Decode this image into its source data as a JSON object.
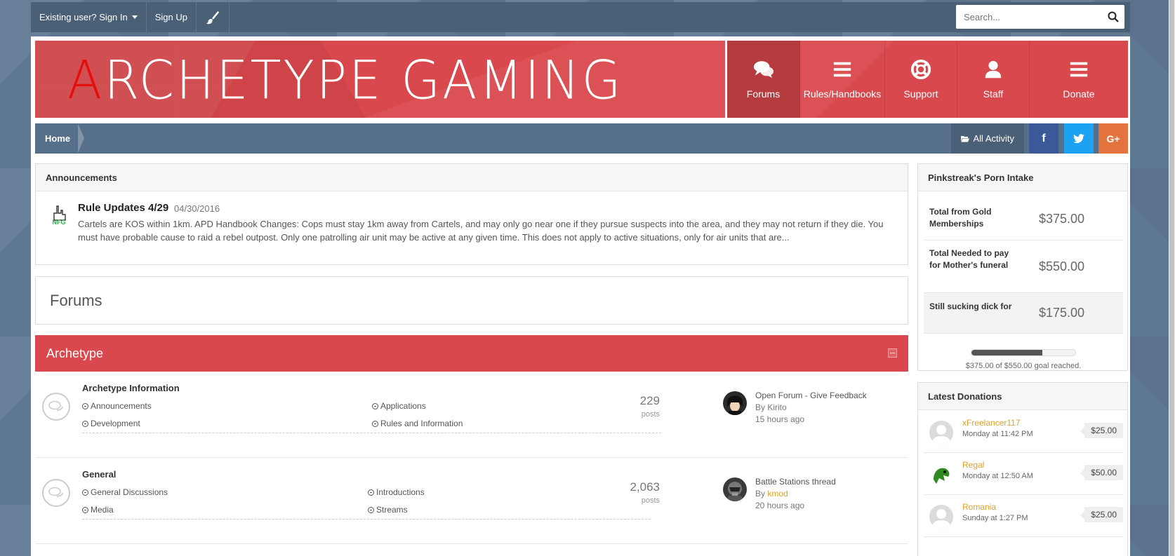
{
  "userbar": {
    "sign_in": "Existing user? Sign In",
    "sign_up": "Sign Up",
    "theme_icon": "paintbrush-icon"
  },
  "search": {
    "placeholder": "Search..."
  },
  "brand": {
    "first_letter": "A",
    "rest": "RCHETYPE GAMING",
    "accent_color": "#e60d0d"
  },
  "nav": [
    {
      "label": "Forums",
      "icon": "comments-icon",
      "active": true
    },
    {
      "label": "Rules/Handbooks",
      "icon": "bars-icon",
      "active": false
    },
    {
      "label": "Support",
      "icon": "lifebuoy-icon",
      "active": false
    },
    {
      "label": "Staff",
      "icon": "user-icon",
      "active": false
    },
    {
      "label": "Donate",
      "icon": "bars-icon",
      "active": false
    }
  ],
  "breadcrumb": {
    "home": "Home",
    "all_activity": "All Activity"
  },
  "social": {
    "facebook": "f",
    "twitter": "twitter-icon",
    "google": "G+"
  },
  "announcements": {
    "heading": "Announcements",
    "title": "Rule Updates 4/29",
    "date": "04/30/2016",
    "body": "Cartels are KOS within 1km. APD Handbook Changes: Cops must stay 1km away from Cartels, and may only go near one if they pursue suspects into the area, and they may not return if they die. You must have probable cause to raid a rebel outpost. Only one patrolling air unit may be active at any given time. This does not apply to active situations, only for air units that are..."
  },
  "forums_heading": "Forums",
  "category": {
    "name": "Archetype",
    "color": "#d9484c"
  },
  "forums": [
    {
      "title": "Archetype Information",
      "subforums": [
        "Announcements",
        "Applications",
        "Development",
        "Rules and Information"
      ],
      "count": "229",
      "count_label": "posts",
      "last_title": "Open Forum - Give Feedback",
      "last_by_prefix": "By ",
      "last_by": "Kirito",
      "last_time": "15 hours ago"
    },
    {
      "title": "General",
      "subforums": [
        "General Discussions",
        "Introductions",
        "Media",
        "Streams"
      ],
      "count": "2,063",
      "count_label": "posts",
      "last_title": "Battle Stations thread",
      "last_by_prefix": "By ",
      "last_by": "kmod",
      "last_time": "20 hours ago"
    }
  ],
  "goal_widget": {
    "heading": "Pinkstreak's Porn Intake",
    "rows": [
      {
        "label": "Total from Gold Memberships",
        "amount": "$375.00"
      },
      {
        "label": "Total Needed to pay for Mother's funeral",
        "amount": "$550.00"
      },
      {
        "label": "Still sucking dick for",
        "amount": "$175.00"
      }
    ],
    "progress_fraction": 0.68,
    "progress_text": "$375.00 of $550.00 goal reached."
  },
  "donations": {
    "heading": "Latest Donations",
    "items": [
      {
        "name": "xFreelancer117",
        "time": "Monday at 11:42 PM",
        "amount": "$25.00"
      },
      {
        "name": "Regal",
        "time": "Monday at 12:50 AM",
        "amount": "$50.00"
      },
      {
        "name": "Romania",
        "time": "Sunday at 1:27 PM",
        "amount": "$25.00"
      }
    ]
  }
}
